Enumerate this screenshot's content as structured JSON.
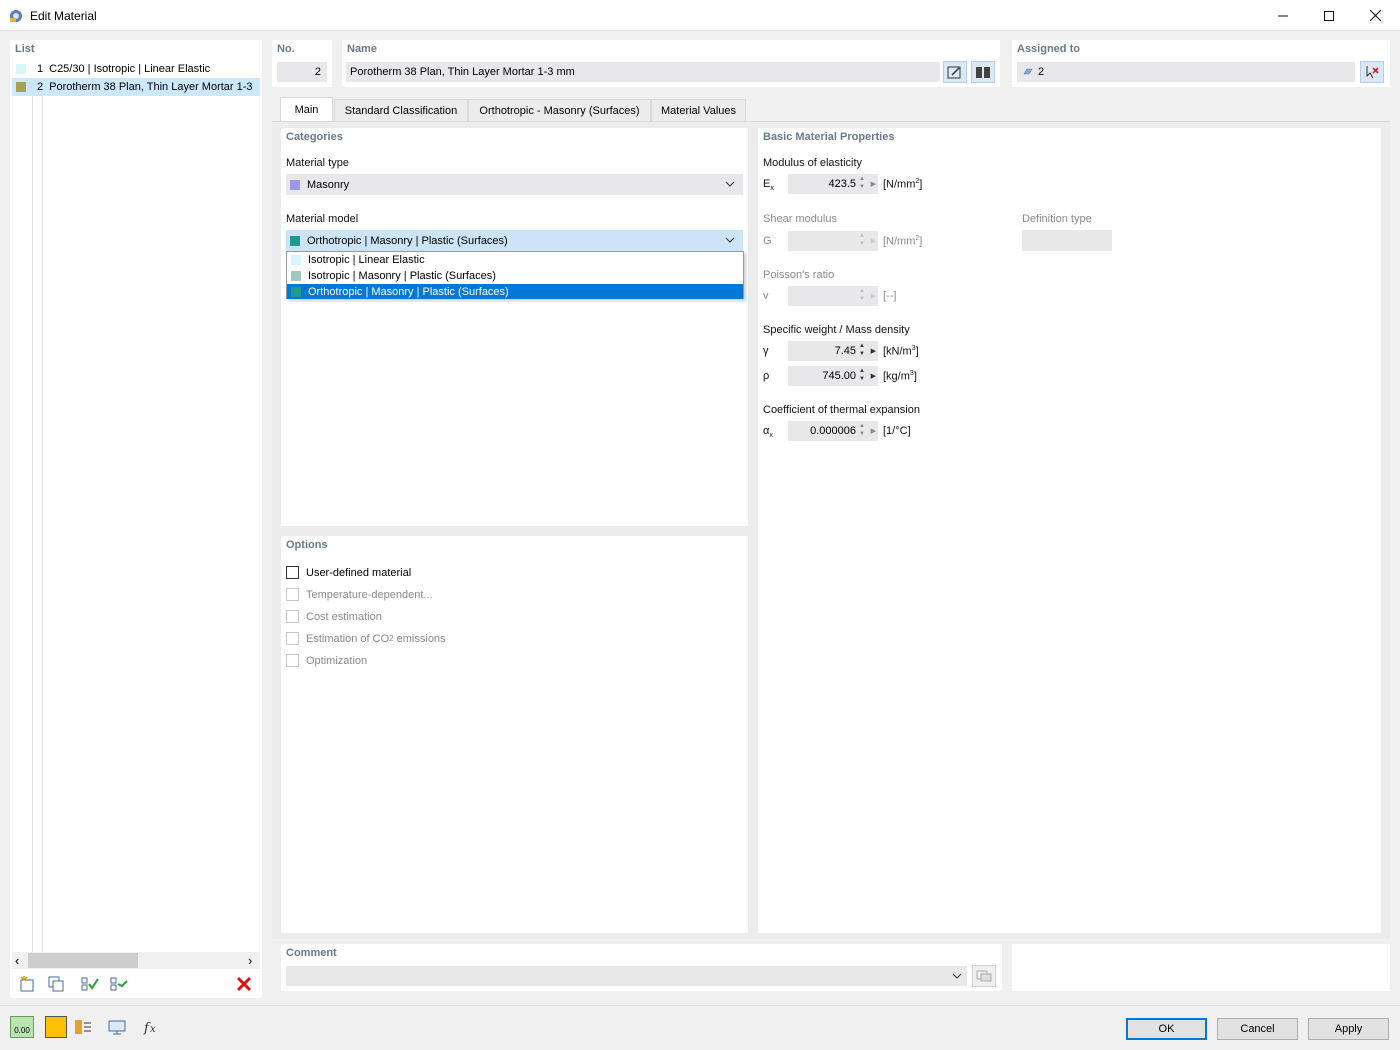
{
  "window": {
    "title": "Edit Material",
    "minimize": "—",
    "maximize": "☐",
    "close": "✕"
  },
  "list": {
    "header": "List",
    "items": [
      {
        "num": "1",
        "label": "C25/30 | Isotropic | Linear Elastic",
        "color": "#d9f7fb"
      },
      {
        "num": "2",
        "label": "Porotherm 38 Plan, Thin Layer Mortar 1-3",
        "color": "#a7a24a"
      }
    ],
    "scroll_left": "‹",
    "scroll_right": "›"
  },
  "header": {
    "no_label": "No.",
    "no_value": "2",
    "name_label": "Name",
    "name_value": "Porotherm 38 Plan, Thin Layer Mortar 1-3 mm",
    "assigned_label": "Assigned to",
    "assigned_value": "2"
  },
  "tabs": [
    "Main",
    "Standard Classification",
    "Orthotropic - Masonry (Surfaces)",
    "Material Values"
  ],
  "categories": {
    "title": "Categories",
    "material_type_label": "Material type",
    "material_type_value": "Masonry",
    "material_type_color": "#9c98f0",
    "material_model_label": "Material model",
    "material_model_value": "Orthotropic | Masonry | Plastic (Surfaces)",
    "material_model_color": "#1f9a8c",
    "options": [
      {
        "label": "Isotropic | Linear Elastic",
        "color": "#d9f7fb"
      },
      {
        "label": "Isotropic | Masonry | Plastic (Surfaces)",
        "color": "#9ec9c3"
      },
      {
        "label": "Orthotropic | Masonry | Plastic (Surfaces)",
        "color": "#1f9a8c"
      }
    ]
  },
  "options_panel": {
    "title": "Options",
    "items": [
      {
        "label": "User-defined material",
        "enabled": true
      },
      {
        "label": "Temperature-dependent...",
        "enabled": false
      },
      {
        "label": "Cost estimation",
        "enabled": false
      },
      {
        "label": "Estimation of CO",
        "sub": "2",
        "tail": " emissions",
        "enabled": false
      },
      {
        "label": "Optimization",
        "enabled": false
      }
    ]
  },
  "props": {
    "title": "Basic Material Properties",
    "modulus_label": "Modulus of elasticity",
    "ex_symbol": "E",
    "ex_sub": "x",
    "ex_value": "423.5",
    "ex_unit": "[N/mm",
    "ex_unit_sup": "2",
    "ex_unit_end": "]",
    "shear_label": "Shear modulus",
    "g_symbol": "G",
    "g_unit": "[N/mm",
    "g_unit_sup": "2",
    "g_unit_end": "]",
    "def_type_label": "Definition type",
    "poisson_label": "Poisson's ratio",
    "v_symbol": "v",
    "v_unit": "[--]",
    "weight_label": "Specific weight / Mass density",
    "gamma_symbol": "γ",
    "gamma_value": "7.45",
    "gamma_unit": "[kN/m",
    "gamma_unit_sup": "3",
    "gamma_unit_end": "]",
    "rho_symbol": "ρ",
    "rho_value": "745.00",
    "rho_unit": "[kg/m",
    "rho_unit_sup": "3",
    "rho_unit_end": "]",
    "thermal_label": "Coefficient of thermal expansion",
    "alpha_symbol": "α",
    "alpha_sub": "x",
    "alpha_value": "0.000006",
    "alpha_unit": "[1/°C]"
  },
  "comment": {
    "label": "Comment",
    "value": ""
  },
  "bottom_bar": {
    "value_badge": "0.00",
    "ok": "OK",
    "cancel": "Cancel",
    "apply": "Apply"
  },
  "colors": {
    "selection": "#0078d7",
    "selected_row": "#cce8ff",
    "focus_field": "#cce4f7"
  }
}
